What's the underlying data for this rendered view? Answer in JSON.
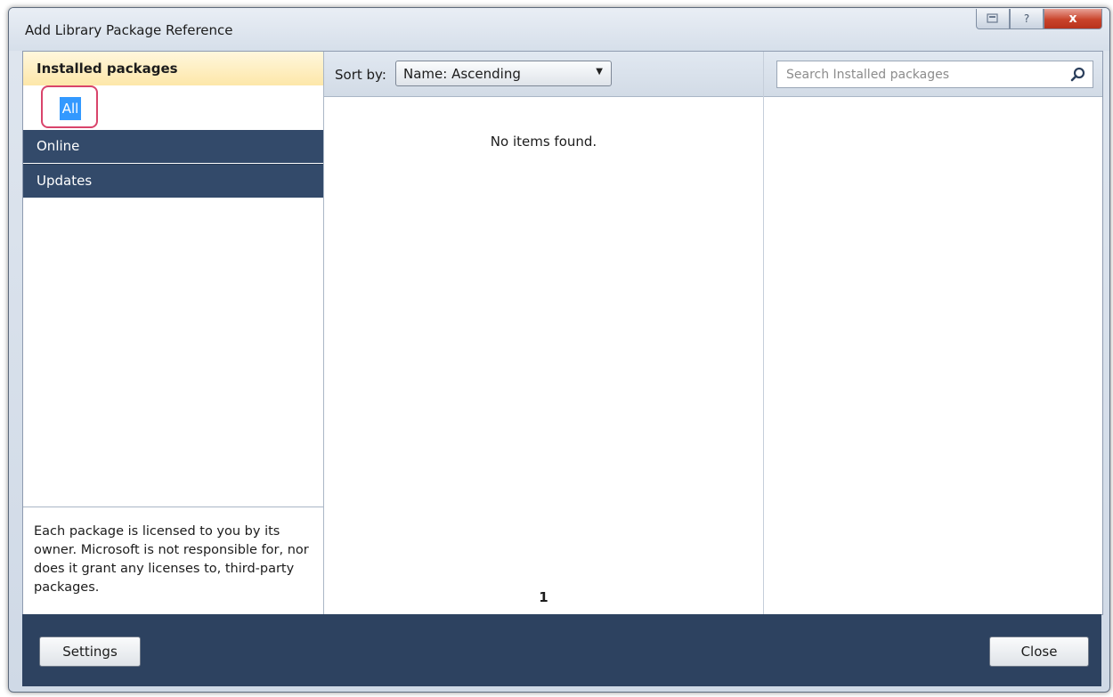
{
  "window": {
    "title": "Add Library Package Reference",
    "caption_help": "?",
    "caption_close": "x"
  },
  "sidebar": {
    "header": "Installed packages",
    "selected_item": "All",
    "items": [
      {
        "label": "Online"
      },
      {
        "label": "Updates"
      }
    ],
    "license_text": "Each package is licensed to you by its owner. Microsoft is not responsible for, nor does it grant any licenses to, third-party packages."
  },
  "sort": {
    "label": "Sort by:",
    "selected": "Name: Ascending"
  },
  "results": {
    "empty_message": "No items found.",
    "page": "1"
  },
  "search": {
    "placeholder": "Search Installed packages",
    "value": ""
  },
  "footer": {
    "settings_label": "Settings",
    "close_label": "Close"
  },
  "colors": {
    "nav_background": "#334a6a",
    "selected_highlight": "#3399ff",
    "focus_ring": "#d9446b",
    "footer_background": "#2d4260",
    "header_background": "#fde7a9"
  },
  "icons": {
    "search": "search-icon",
    "help": "help-icon",
    "close": "close-icon",
    "small_caption": "caption-small-icon"
  }
}
